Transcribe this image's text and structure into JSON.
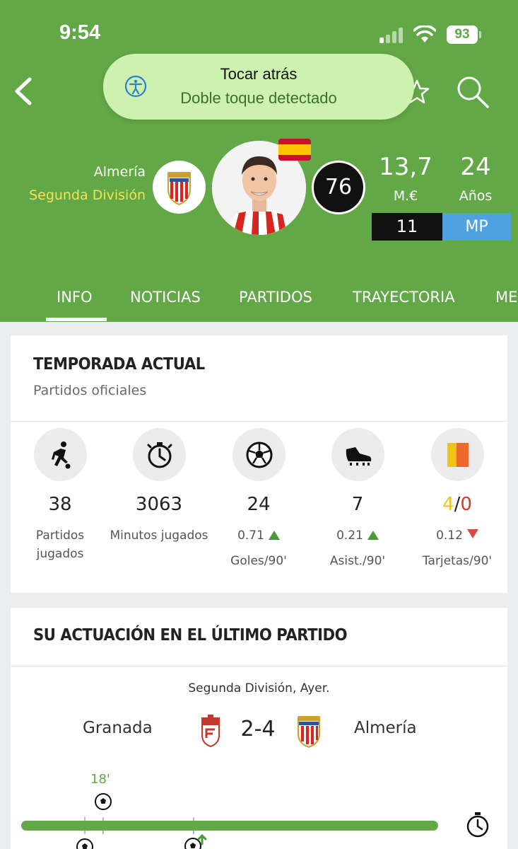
{
  "status_bar": {
    "time": "9:54",
    "battery": "93"
  },
  "toast": {
    "title": "Tocar atrás",
    "subtitle": "Doble toque detectado"
  },
  "player": {
    "team": "Almería",
    "league": "Segunda División",
    "rating": "76",
    "value": "13,7",
    "value_unit": "M.€",
    "age": "24",
    "age_unit": "Años",
    "shirt_number": "11",
    "position": "MP"
  },
  "tabs": [
    "INFO",
    "NOTICIAS",
    "PARTIDOS",
    "TRAYECTORIA",
    "ME"
  ],
  "season_card": {
    "title": "TEMPORADA ACTUAL",
    "subtitle": "Partidos oficiales",
    "stats": [
      {
        "icon": "player-running-icon",
        "value": "38",
        "label_1": "Partidos",
        "label_2": "jugados"
      },
      {
        "icon": "stopwatch-icon",
        "value": "3063",
        "label_1": "Minutos jugados"
      },
      {
        "icon": "soccer-ball-icon",
        "value": "24",
        "rate": "0.71",
        "trend": "up",
        "label_1": "Goles/90'"
      },
      {
        "icon": "football-boot-icon",
        "value": "7",
        "rate": "0.21",
        "trend": "up",
        "label_1": "Asist./90'"
      },
      {
        "icon": "cards-icon",
        "yellow": "4",
        "separator": "/",
        "red": "0",
        "rate": "0.12",
        "trend": "down",
        "label_1": "Tarjetas/90'"
      }
    ]
  },
  "last_match_card": {
    "title": "SU ACTUACIÓN EN EL ÚLTIMO PARTIDO",
    "meta": "Segunda División, Ayer.",
    "home_team": "Granada",
    "score": "2-4",
    "away_team": "Almería",
    "event_minute": "18'"
  },
  "colors": {
    "header_green": "#62a846",
    "league_yellow": "#f1e25a",
    "position_blue": "#4fa2e0",
    "yellow_card": "#f0c419",
    "red_card": "#e0352b",
    "trend_up": "#4a9a3a",
    "trend_down": "#d84a4a"
  }
}
